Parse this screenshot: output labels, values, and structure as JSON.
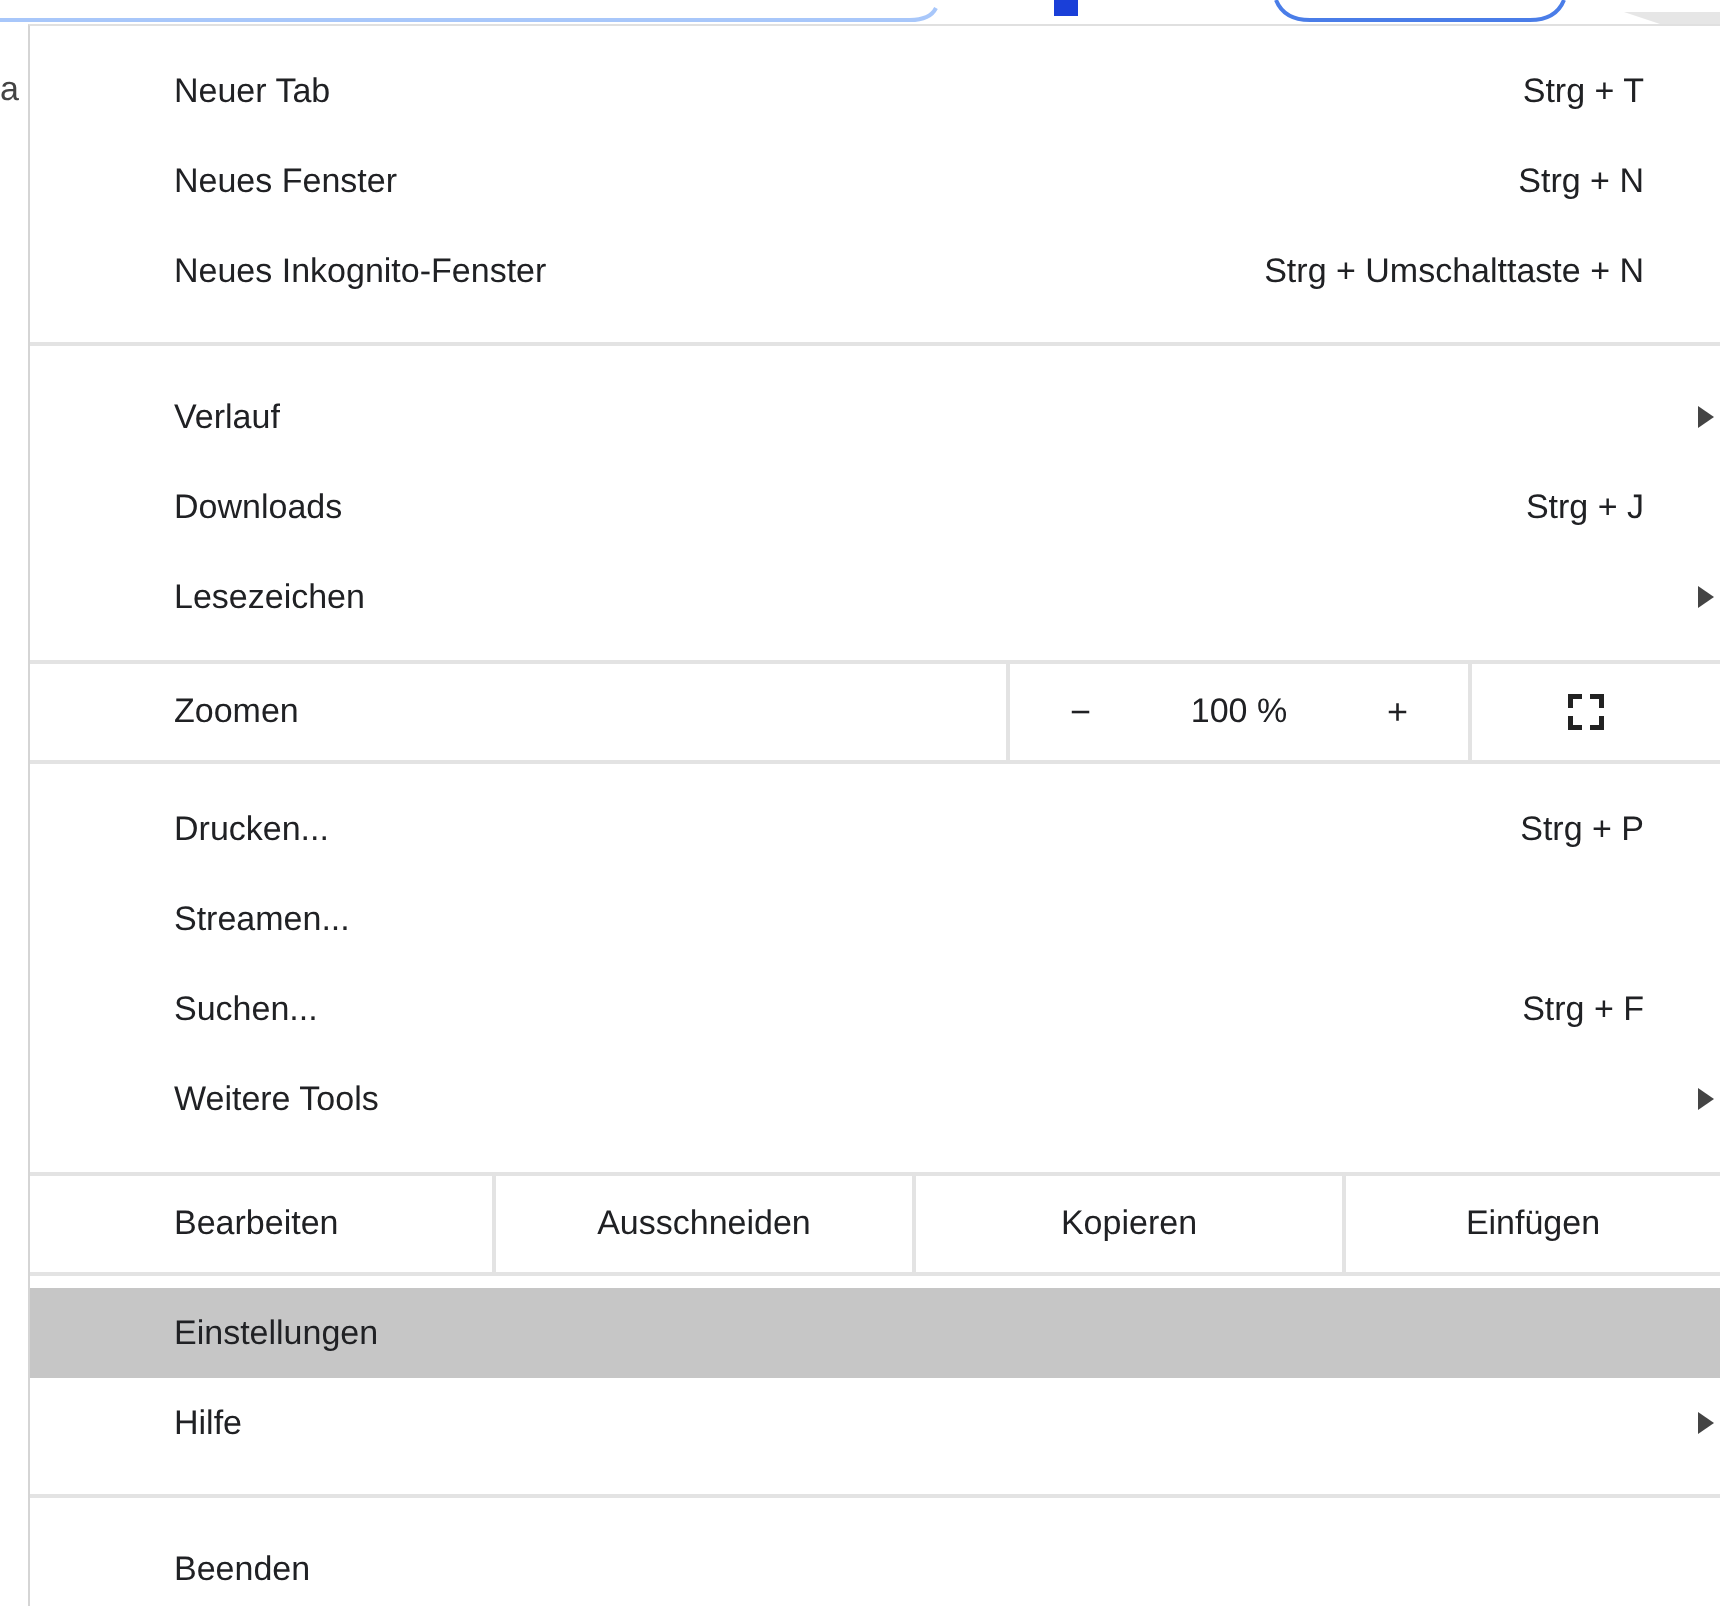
{
  "background_text": "a",
  "menu": [
    {
      "kind": "item",
      "label": "Neuer Tab",
      "shortcut": "Strg + T",
      "submenu": false,
      "highlighted": false
    },
    {
      "kind": "item",
      "label": "Neues Fenster",
      "shortcut": "Strg + N",
      "submenu": false,
      "highlighted": false
    },
    {
      "kind": "item",
      "label": "Neues Inkognito-Fenster",
      "shortcut": "Strg + Umschalttaste + N",
      "submenu": false,
      "highlighted": false
    },
    {
      "kind": "separator"
    },
    {
      "kind": "item",
      "label": "Verlauf",
      "submenu": true,
      "highlighted": false
    },
    {
      "kind": "item",
      "label": "Downloads",
      "shortcut": "Strg + J",
      "submenu": false,
      "highlighted": false
    },
    {
      "kind": "item",
      "label": "Lesezeichen",
      "submenu": true,
      "highlighted": false
    },
    {
      "kind": "zoom",
      "label": "Zoomen",
      "minus": "−",
      "value": "100 %",
      "plus": "+"
    },
    {
      "kind": "item",
      "label": "Drucken...",
      "shortcut": "Strg + P",
      "submenu": false,
      "highlighted": false
    },
    {
      "kind": "item",
      "label": "Streamen...",
      "submenu": false,
      "highlighted": false
    },
    {
      "kind": "item",
      "label": "Suchen...",
      "shortcut": "Strg + F",
      "submenu": false,
      "highlighted": false
    },
    {
      "kind": "item",
      "label": "Weitere Tools",
      "submenu": true,
      "highlighted": false
    },
    {
      "kind": "edit",
      "label": "Bearbeiten",
      "actions": [
        "Ausschneiden",
        "Kopieren",
        "Einfügen"
      ]
    },
    {
      "kind": "item",
      "label": "Einstellungen",
      "submenu": false,
      "highlighted": true
    },
    {
      "kind": "item",
      "label": "Hilfe",
      "submenu": true,
      "highlighted": false
    },
    {
      "kind": "separator"
    },
    {
      "kind": "item",
      "label": "Beenden",
      "submenu": false,
      "highlighted": false
    }
  ]
}
